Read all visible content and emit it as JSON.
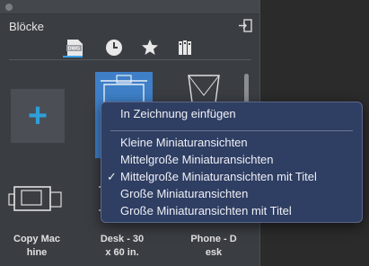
{
  "panel": {
    "title": "Blöcke",
    "tabs": [
      {
        "name": "DWG",
        "label": "DWG"
      },
      {
        "name": "Zuletzt",
        "icon": "clock-icon"
      },
      {
        "name": "Favoriten",
        "icon": "star-icon"
      },
      {
        "name": "Bibliotheken",
        "icon": "library-icon"
      }
    ],
    "thumbnails": [
      {
        "label_line1": "Copy Mac",
        "label_line2": "hine"
      },
      {
        "label_line1": "Desk - 30",
        "label_line2": "x 60 in."
      },
      {
        "label_line1": "Phone - D",
        "label_line2": "esk"
      }
    ]
  },
  "context_menu": {
    "insert": "In Zeichnung einfügen",
    "items": [
      {
        "label": "Kleine Miniaturansichten",
        "checked": false
      },
      {
        "label": "Mittelgroße Miniaturansichten",
        "checked": false
      },
      {
        "label": "Mittelgroße Miniaturansichten mit Titel",
        "checked": true
      },
      {
        "label": "Große Miniaturansichten",
        "checked": false
      },
      {
        "label": "Große Miniaturansichten mit Titel",
        "checked": false
      }
    ],
    "check_glyph": "✓"
  },
  "colors": {
    "accent": "#3aa0e8",
    "menu_bg": "#2f3e63",
    "selected_tile": "#3e7fc7"
  }
}
